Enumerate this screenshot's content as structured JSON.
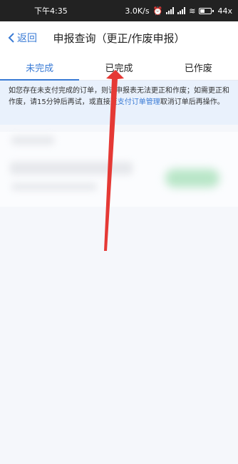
{
  "status_bar": {
    "time": "下午4:35",
    "speed": "3.0K/s",
    "battery": "44",
    "battery_level": 0.44
  },
  "nav": {
    "back_label": "返回",
    "title": "申报查询（更正/作废申报）"
  },
  "tabs": [
    {
      "label": "未完成",
      "active": true
    },
    {
      "label": "已完成",
      "active": false
    },
    {
      "label": "已作废",
      "active": false
    }
  ],
  "notice": {
    "text_before": "如您存在未支付完成的订单，则该申报表无法更正和作废；如需更正和作废，请15分钟后再试，或直接至",
    "link": "支付订单管理",
    "text_after": "取消订单后再操作。"
  },
  "colors": {
    "accent": "#3a7bd5",
    "notice_bg": "#e9f1fc",
    "annotation_arrow": "#e53935"
  },
  "icons": {
    "back": "chevron-left-icon",
    "wifi": "wifi-icon",
    "battery": "battery-icon",
    "signal": "signal-icon",
    "alarm": "alarm-off-icon"
  }
}
